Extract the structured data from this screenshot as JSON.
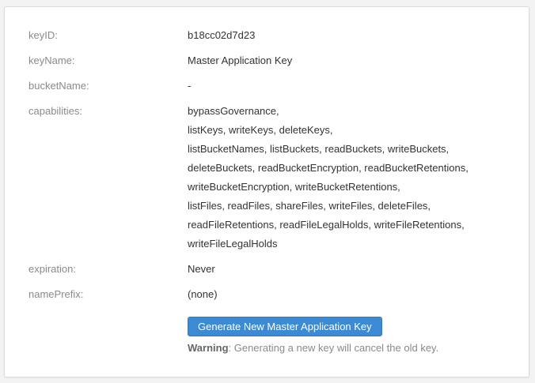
{
  "key": {
    "rows": [
      {
        "label": "keyID:",
        "value": "b18cc02d7d23"
      },
      {
        "label": "keyName:",
        "value": "Master Application Key"
      },
      {
        "label": "bucketName:",
        "value": "-"
      }
    ],
    "capabilities_label": "capabilities:",
    "capabilities_lines": [
      "bypassGovernance,",
      "listKeys, writeKeys, deleteKeys,",
      "listBucketNames, listBuckets, readBuckets, writeBuckets,",
      "deleteBuckets, readBucketEncryption, readBucketRetentions,",
      "writeBucketEncryption, writeBucketRetentions,",
      "listFiles, readFiles, shareFiles, writeFiles, deleteFiles,",
      "readFileRetentions, readFileLegalHolds, writeFileRetentions,",
      "writeFileLegalHolds"
    ],
    "expiration_label": "expiration:",
    "expiration_value": "Never",
    "name_prefix_label": "namePrefix:",
    "name_prefix_value": "(none)"
  },
  "actions": {
    "generate_button_label": "Generate New Master Application Key",
    "warning_title": "Warning",
    "warning_text": ": Generating a new key will cancel the old key."
  },
  "colors": {
    "button": "#3d8ad4",
    "label": "#8a8a8a",
    "value": "#333333"
  }
}
